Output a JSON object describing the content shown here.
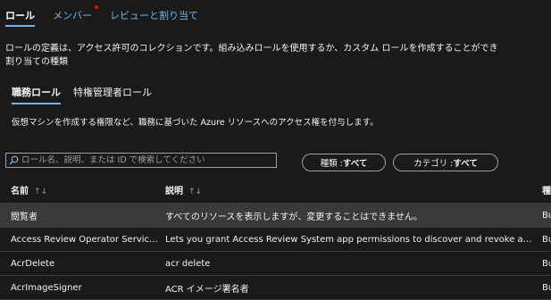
{
  "top_tabs": [
    {
      "label": "ロール"
    },
    {
      "label": "メンバー"
    },
    {
      "label": "レビューと割り当て"
    }
  ],
  "description": "ロールの定義は、アクセス許可のコレクションです。組み込みロールを使用するか、カスタム ロールを作成することができ",
  "assignment_type": "割り当ての種類",
  "sub_tabs": [
    {
      "label": "職務ロール"
    },
    {
      "label": "特権管理者ロール"
    }
  ],
  "sub_description": "仮想マシンを作成する権限など、職務に基づいた Azure リソースへのアクセス権を付与します。",
  "search": {
    "placeholder": "ロール名、説明、または ID で検索してください"
  },
  "filters": {
    "type_label": "種類 : ",
    "type_value": "すべて",
    "category_label": "カテゴリ : ",
    "category_value": "すべて"
  },
  "table": {
    "headers": {
      "name": "名前",
      "description": "説明",
      "type": "種"
    },
    "rows": [
      {
        "name": "閲覧者",
        "description": "すべてのリソースを表示しますが、変更することはできません。",
        "type": "Bu"
      },
      {
        "name": "Access Review Operator Servic...",
        "description": "Lets you grant Access Review System app permissions to discover and revoke acc...",
        "type": "Bu"
      },
      {
        "name": "AcrDelete",
        "description": "acr delete",
        "type": "Bu"
      },
      {
        "name": "AcrImageSigner",
        "description": "ACR イメージ署名者",
        "type": "Bu"
      }
    ]
  },
  "colors": {
    "accent": "#6cb8f6",
    "background": "#1b1a19",
    "selected_row": "#3b3a39",
    "notification_dot": "#e81123"
  }
}
